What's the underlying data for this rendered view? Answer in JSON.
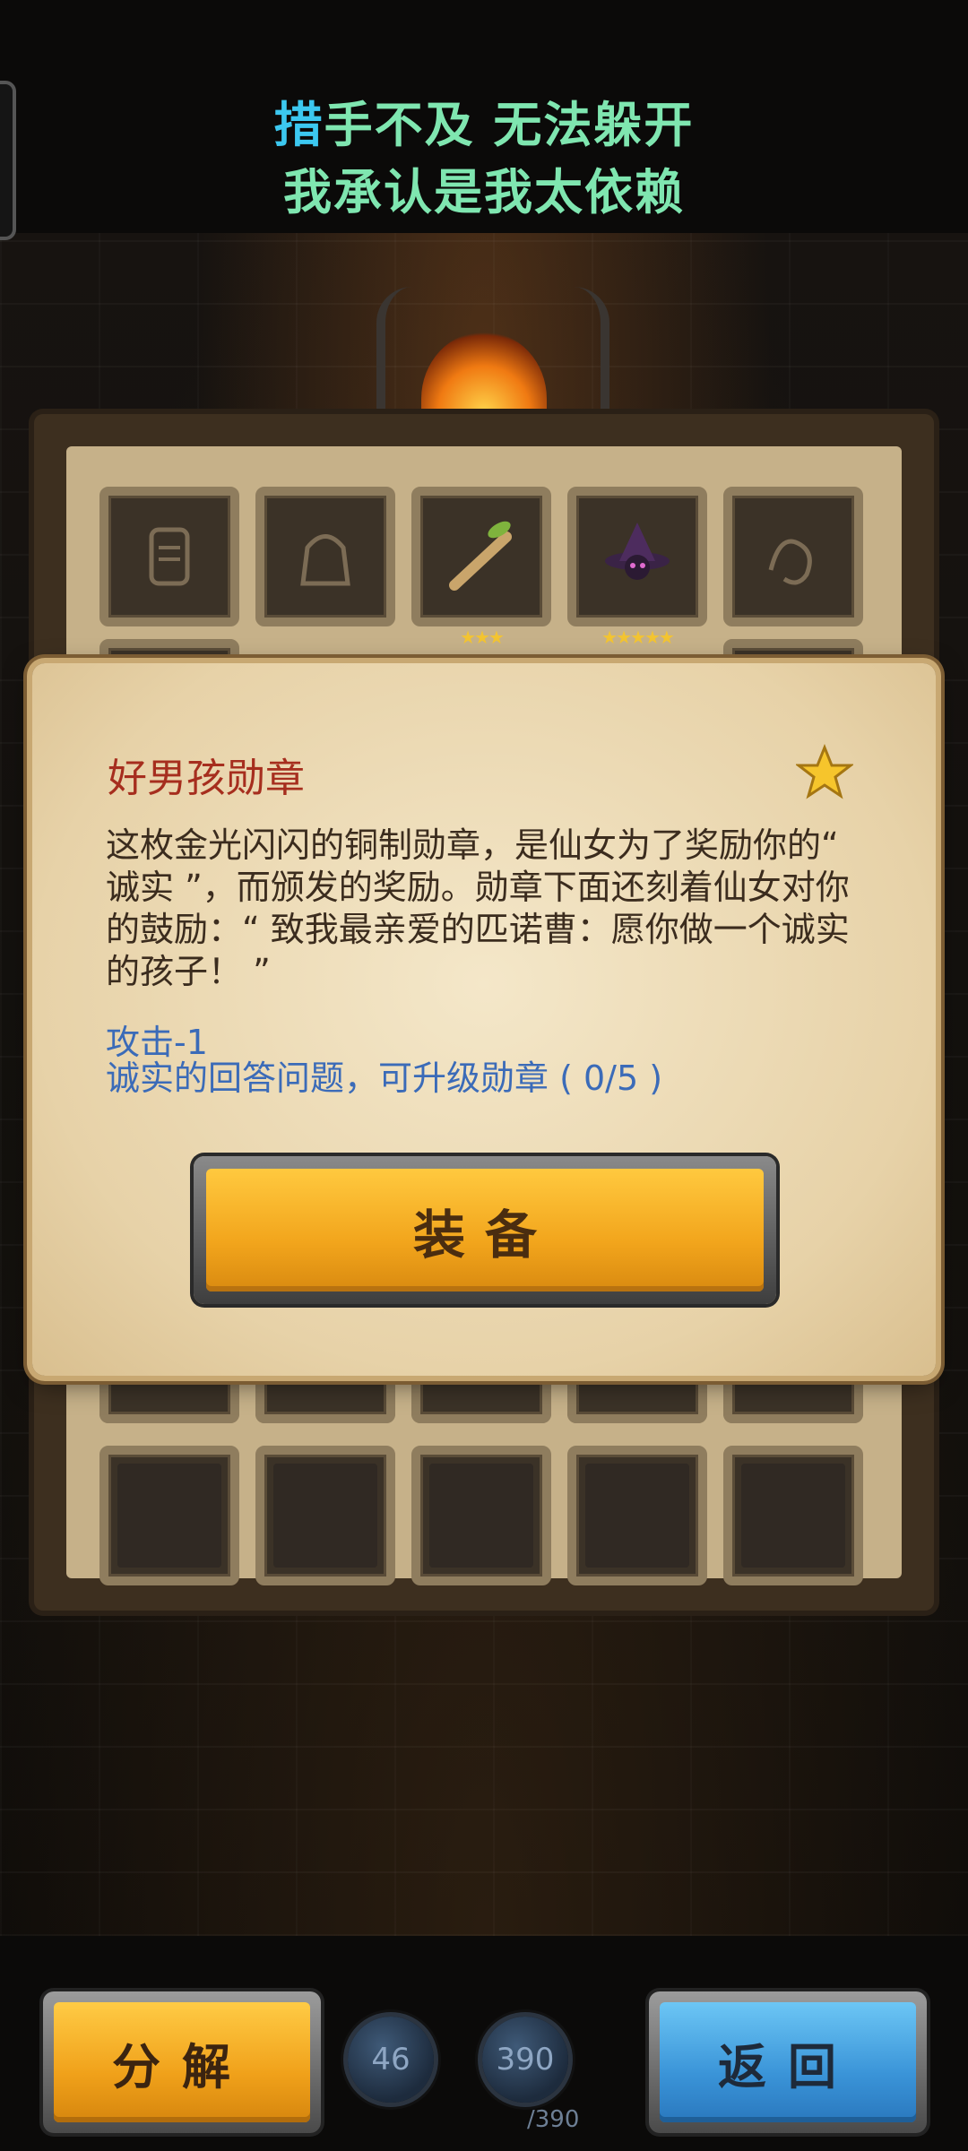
{
  "lyrics": {
    "line1_highlight": "措",
    "line1_rest": "手不及  无法躲开",
    "line2": "我承认是我太依赖"
  },
  "inventory": {
    "row1": [
      {
        "icon": "scroll-silhouette-icon",
        "stars": ""
      },
      {
        "icon": "bag-silhouette-icon",
        "stars": ""
      },
      {
        "icon": "wooden-stick-icon",
        "stars": "★★★"
      },
      {
        "icon": "witch-hat-icon",
        "stars": "★★★★★"
      },
      {
        "icon": "rope-silhouette-icon",
        "stars": ""
      }
    ]
  },
  "dialog": {
    "title": "好男孩勋章",
    "star_icon": "star-icon",
    "description": "这枚金光闪闪的铜制勋章，是仙女为了奖励你的“ 诚实 ”，而颁发的奖励。勋章下面还刻着仙女对你的鼓励：“ 致我最亲爱的匹诺曹：愿你做一个诚实的孩子！ ”",
    "stat_line": "攻击-1",
    "upgrade_line": "诚实的回答问题，可升级勋章 ( 0/5 )",
    "equip_label": "装备"
  },
  "bottom": {
    "decompose_label": "分解",
    "potion_count": "46",
    "capacity_current": "390",
    "capacity_max": "/390",
    "back_label": "返回"
  },
  "colors": {
    "lyric": "#7fe6b0",
    "lyric_highlight": "#3cc8f0",
    "title": "#a62e1e",
    "stat": "#3b6bb8",
    "button_yellow": "#f2a51c",
    "button_blue": "#3a94d8"
  }
}
